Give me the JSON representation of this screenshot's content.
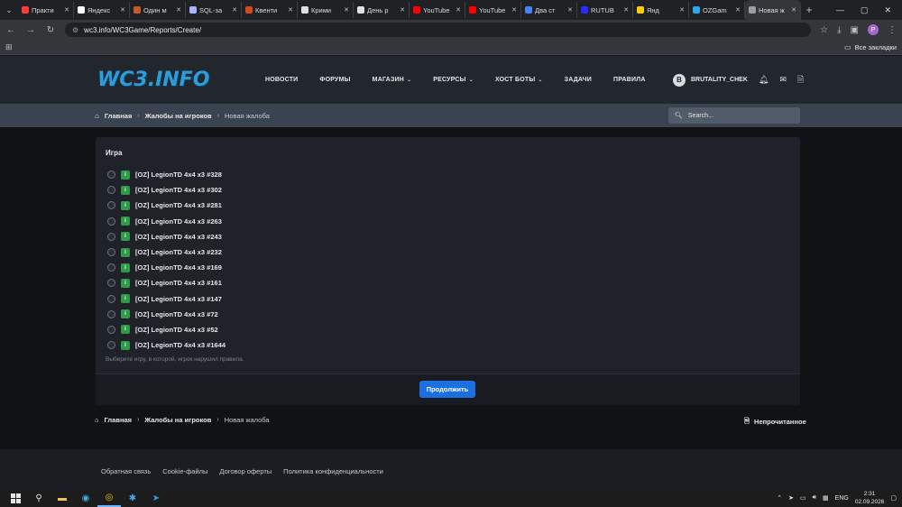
{
  "browser": {
    "tabs": [
      {
        "label": "Практи",
        "color": "#ff3b3b",
        "active": false
      },
      {
        "label": "Яндекс",
        "color": "#ffffff",
        "active": false
      },
      {
        "label": "Один м",
        "color": "#c45a2a",
        "active": false
      },
      {
        "label": "SQL-за",
        "color": "#a8b3ff",
        "active": false
      },
      {
        "label": "Квенти",
        "color": "#d14a1e",
        "active": false
      },
      {
        "label": "Крими",
        "color": "#e0e0e0",
        "active": false
      },
      {
        "label": "День р",
        "color": "#e0e0e0",
        "active": false
      },
      {
        "label": "YouTube",
        "color": "#ff0000",
        "active": false
      },
      {
        "label": "YouTube",
        "color": "#ff0000",
        "active": false
      },
      {
        "label": "Два ст",
        "color": "#4285f4",
        "active": false
      },
      {
        "label": "RUTUB",
        "color": "#2b2bff",
        "active": false
      },
      {
        "label": "Янд",
        "color": "#ffcc00",
        "active": false
      },
      {
        "label": "OZGam",
        "color": "#29a9eb",
        "active": false
      },
      {
        "label": "Новая ж",
        "color": "#9aa0a6",
        "active": true
      }
    ],
    "url": "wc3.info/WC3Game/Reports/Create/",
    "bookmarks_all": "Все закладки",
    "profile_letter": "P"
  },
  "site": {
    "logo": "WC3.INFO",
    "nav": [
      {
        "label": "НОВОСТИ",
        "caret": false
      },
      {
        "label": "ФОРУМЫ",
        "caret": false
      },
      {
        "label": "МАГАЗИН",
        "caret": true
      },
      {
        "label": "РЕСУРСЫ",
        "caret": true
      },
      {
        "label": "ХОСТ БОТЫ",
        "caret": true
      },
      {
        "label": "ЗАДАЧИ",
        "caret": false
      },
      {
        "label": "ПРАВИЛА",
        "caret": false
      }
    ],
    "user": {
      "avatar_letter": "B",
      "name": "BRUTALITY_CHEK"
    },
    "search_placeholder": "Search...",
    "breadcrumb": {
      "home": "Главная",
      "section": "Жалобы на игроков",
      "current": "Новая жалоба"
    }
  },
  "form": {
    "field_label": "Игра",
    "games": [
      "[OZ] LegionTD 4x4 x3 #328",
      "[OZ] LegionTD 4x4 x3 #302",
      "[OZ] LegionTD 4x4 x3 #281",
      "[OZ] LegionTD 4x4 x3 #263",
      "[OZ] LegionTD 4x4 x3 #243",
      "[OZ] LegionTD 4x4 x3 #232",
      "[OZ] LegionTD 4x4 x3 #169",
      "[OZ] LegionTD 4x4 x3 #161",
      "[OZ] LegionTD 4x4 x3 #147",
      "[OZ] LegionTD 4x4 x3 #72",
      "[OZ] LegionTD 4x4 x3 #52",
      "[OZ] LegionTD 4x4 x3 #1644"
    ],
    "hint": "Выберите игру, в которой, игрок нарушил правила.",
    "submit_label": "Продолжить"
  },
  "bottom": {
    "unread_label": "Непрочитанное"
  },
  "footer": {
    "links": [
      "Обратная связь",
      "Cookie-файлы",
      "Договор оферты",
      "Политика конфиденциальности"
    ]
  },
  "taskbar": {
    "lang": "ENG",
    "time": "2:31",
    "date": "02.09.2026"
  }
}
